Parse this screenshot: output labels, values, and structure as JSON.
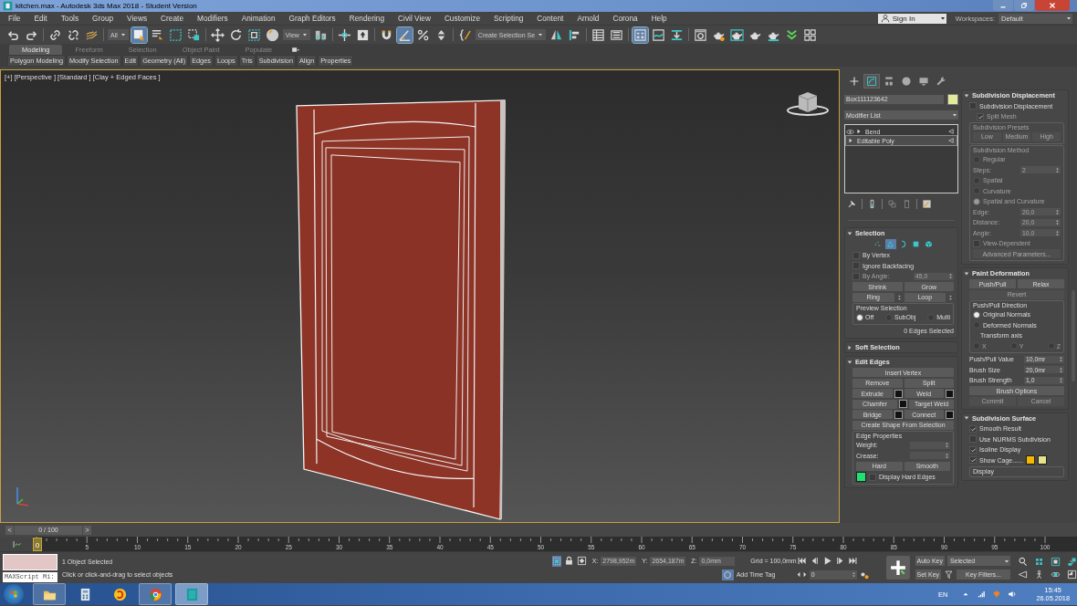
{
  "window": {
    "title": "kitchen.max - Autodesk 3ds Max 2018 - Student Version"
  },
  "menu": [
    "File",
    "Edit",
    "Tools",
    "Group",
    "Views",
    "Create",
    "Modifiers",
    "Animation",
    "Graph Editors",
    "Rendering",
    "Civil View",
    "Customize",
    "Scripting",
    "Content",
    "Arnold",
    "Corona",
    "Help"
  ],
  "account": {
    "sign_in": "Sign In",
    "workspaces_label": "Workspaces:",
    "workspace": "Default"
  },
  "toolbar": {
    "items": [
      {
        "kind": "undo",
        "selected": false
      },
      {
        "kind": "redo",
        "selected": false
      },
      {
        "kind": "sep"
      },
      {
        "kind": "link",
        "selected": false
      },
      {
        "kind": "unlink",
        "selected": false
      },
      {
        "kind": "wave",
        "selected": false
      },
      {
        "kind": "sep"
      },
      {
        "kind": "dropdown",
        "value": "All"
      },
      {
        "kind": "select",
        "selected": true
      },
      {
        "kind": "list",
        "selected": false
      },
      {
        "kind": "region",
        "selected": false
      },
      {
        "kind": "window",
        "selected": false
      },
      {
        "kind": "sep"
      },
      {
        "kind": "move",
        "selected": false
      },
      {
        "kind": "rotate",
        "selected": false
      },
      {
        "kind": "scale",
        "selected": false
      },
      {
        "kind": "sphere",
        "selected": false
      },
      {
        "kind": "dropdown",
        "value": "View"
      },
      {
        "kind": "pivot",
        "selected": false
      },
      {
        "kind": "sep"
      },
      {
        "kind": "crosshair",
        "selected": false
      },
      {
        "kind": "keyboard",
        "selected": false
      },
      {
        "kind": "sep"
      },
      {
        "kind": "snap",
        "selected": false
      },
      {
        "kind": "angle",
        "selected": true
      },
      {
        "kind": "percent",
        "selected": false
      },
      {
        "kind": "spinner",
        "selected": false
      },
      {
        "kind": "sep"
      },
      {
        "kind": "braces",
        "selected": false
      },
      {
        "kind": "dropdown",
        "value": "Create Selection Se"
      },
      {
        "kind": "mirror",
        "selected": false
      },
      {
        "kind": "align",
        "selected": false
      },
      {
        "kind": "sep"
      },
      {
        "kind": "table",
        "selected": false
      },
      {
        "kind": "layers",
        "selected": false
      },
      {
        "kind": "sep"
      },
      {
        "kind": "panels",
        "selected": true
      },
      {
        "kind": "curve",
        "selected": false
      },
      {
        "kind": "download",
        "selected": false
      },
      {
        "kind": "sep"
      },
      {
        "kind": "render",
        "selected": false
      },
      {
        "kind": "teapot-gear",
        "selected": false
      },
      {
        "kind": "teapot-frame",
        "selected": false
      },
      {
        "kind": "teapot",
        "selected": false
      },
      {
        "kind": "teapot-cloud",
        "selected": false
      },
      {
        "kind": "chevrons",
        "selected": false
      },
      {
        "kind": "grid",
        "selected": false
      }
    ]
  },
  "ribbon": {
    "tabs": [
      {
        "label": "Modeling",
        "selected": true
      },
      {
        "label": "Freeform",
        "selected": false
      },
      {
        "label": "Selection",
        "selected": false
      },
      {
        "label": "Object Paint",
        "selected": false
      },
      {
        "label": "Populate",
        "selected": false
      }
    ],
    "panels": [
      "Polygon Modeling",
      "Modify Selection",
      "Edit",
      "Geometry (All)",
      "Edges",
      "Loops",
      "Tris",
      "Subdivision",
      "Align",
      "Properties"
    ]
  },
  "viewport": {
    "labels": [
      "[+]",
      "[Perspective ]",
      "[Standard ]",
      "[Clay + Edged Faces ]"
    ]
  },
  "command_panel": {
    "tabs": [
      {
        "kind": "create",
        "selected": false
      },
      {
        "kind": "modify",
        "selected": true
      },
      {
        "kind": "hierarchy",
        "selected": false
      },
      {
        "kind": "motion",
        "selected": false
      },
      {
        "kind": "display",
        "selected": false
      },
      {
        "kind": "utilities",
        "selected": false
      }
    ],
    "object_name": "Box111123642",
    "object_swatch": {
      "color": "#e2eb9c"
    },
    "modifier_list": "Modifier List",
    "stack": [
      {
        "label": "Bend",
        "visible": true,
        "selected": false
      },
      {
        "label": "Editable Poly",
        "visible": false,
        "selected": true
      }
    ],
    "rollouts_left": [
      {
        "title": "Selection",
        "expanded": true,
        "rows": [
          {
            "kind": "levels",
            "levels": [
              {
                "selected": false
              },
              {
                "selected": true
              },
              {
                "selected": false
              },
              {
                "selected": false
              },
              {
                "selected": false
              }
            ]
          },
          {
            "kind": "check",
            "label": "By Vertex",
            "checked": false,
            "disabled": false
          },
          {
            "kind": "check",
            "label": "Ignore Backfacing",
            "checked": false,
            "disabled": false
          },
          {
            "kind": "check-spin",
            "label": "By Angle:",
            "value": "45,0",
            "checked": false,
            "disabled": true
          },
          {
            "kind": "buttons",
            "buttons": [
              {
                "label": "Shrink",
                "disabled": false
              },
              {
                "label": "Grow",
                "disabled": false
              }
            ]
          },
          {
            "kind": "buttons",
            "buttons": [
              {
                "label": "Ring",
                "disabled": false,
                "spinner": true
              },
              {
                "label": "Loop",
                "disabled": false,
                "spinner": true
              }
            ]
          },
          {
            "kind": "group",
            "title": "Preview Selection",
            "disabled": false,
            "rows": [
              {
                "kind": "radio-row",
                "options": [
                  {
                    "label": "Off",
                    "selected": true,
                    "disabled": false
                  },
                  {
                    "label": "SubObj",
                    "selected": false,
                    "disabled": false
                  },
                  {
                    "label": "Multi",
                    "selected": false,
                    "disabled": false
                  }
                ]
              }
            ]
          },
          {
            "kind": "note",
            "text": "0 Edges Selected"
          }
        ]
      },
      {
        "title": "Soft Selection",
        "expanded": false
      },
      {
        "title": "Edit Edges",
        "expanded": true,
        "rows": [
          {
            "kind": "buttons",
            "buttons": [
              {
                "label": "Insert Vertex",
                "disabled": false
              }
            ]
          },
          {
            "kind": "buttons",
            "buttons": [
              {
                "label": "Remove",
                "disabled": false
              },
              {
                "label": "Split",
                "disabled": false
              }
            ]
          },
          {
            "kind": "buttons",
            "buttons": [
              {
                "label": "Extrude",
                "disabled": false,
                "settings": true
              },
              {
                "label": "Weld",
                "disabled": false,
                "settings": true
              }
            ]
          },
          {
            "kind": "buttons",
            "buttons": [
              {
                "label": "Chamfer",
                "disabled": false,
                "settings": true
              },
              {
                "label": "Target Weld",
                "disabled": false
              }
            ]
          },
          {
            "kind": "buttons",
            "buttons": [
              {
                "label": "Bridge",
                "disabled": false,
                "settings": true
              },
              {
                "label": "Connect",
                "disabled": false,
                "settings": true
              }
            ]
          },
          {
            "kind": "buttons",
            "buttons": [
              {
                "label": "Create Shape From Selection",
                "disabled": false
              }
            ]
          },
          {
            "kind": "group",
            "title": "Edge Properties",
            "disabled": false,
            "rows": [
              {
                "kind": "spin",
                "label": "Weight:",
                "disabled": false
              },
              {
                "kind": "spin",
                "label": "Crease:",
                "disabled": false
              },
              {
                "kind": "buttons",
                "buttons": [
                  {
                    "label": "Hard",
                    "disabled": false
                  },
                  {
                    "label": "Smooth",
                    "disabled": false
                  }
                ]
              },
              {
                "kind": "check",
                "label": "Display Hard Edges",
                "checked": false,
                "disabled": false,
                "swatch": {
                  "color": "#22e070"
                }
              }
            ]
          }
        ]
      }
    ],
    "rollouts_right": [
      {
        "title": "Subdivision Displacement",
        "expanded": true,
        "rows": [
          {
            "kind": "check",
            "label": "Subdivision Displacement",
            "checked": false,
            "disabled": false
          },
          {
            "kind": "subcheck",
            "label": "Split Mesh",
            "checked": true,
            "disabled": true
          },
          {
            "kind": "group",
            "title": "Subdivision Presets",
            "disabled": true,
            "rows": [
              {
                "kind": "buttons",
                "buttons": [
                  {
                    "label": "Low",
                    "disabled": true
                  },
                  {
                    "label": "Medium",
                    "disabled": true
                  },
                  {
                    "label": "High",
                    "disabled": true
                  }
                ]
              }
            ]
          },
          {
            "kind": "group",
            "title": "Subdivision Method",
            "disabled": true,
            "rows": [
              {
                "kind": "radio",
                "label": "Regular",
                "selected": false,
                "disabled": true
              },
              {
                "kind": "spin",
                "label": "Steps:",
                "value": "2",
                "disabled": true
              },
              {
                "kind": "radio",
                "label": "Spatial",
                "selected": false,
                "disabled": true
              },
              {
                "kind": "radio",
                "label": "Curvature",
                "selected": false,
                "disabled": true
              },
              {
                "kind": "radio",
                "label": "Spatial and Curvature",
                "selected": true,
                "disabled": true
              },
              {
                "kind": "spin",
                "label": "Edge:",
                "value": "20,0",
                "disabled": true
              },
              {
                "kind": "spin",
                "label": "Distance:",
                "value": "20,0",
                "disabled": true
              },
              {
                "kind": "spin",
                "label": "Angle:",
                "value": "10,0",
                "disabled": true
              },
              {
                "kind": "check",
                "label": "View-Dependent",
                "checked": false,
                "disabled": true
              },
              {
                "kind": "buttons",
                "buttons": [
                  {
                    "label": "Advanced Parameters...",
                    "disabled": true
                  }
                ]
              }
            ]
          }
        ]
      },
      {
        "title": "Paint Deformation",
        "expanded": true,
        "rows": [
          {
            "kind": "buttons",
            "buttons": [
              {
                "label": "Push/Pull",
                "disabled": false
              },
              {
                "label": "Relax",
                "disabled": false
              }
            ]
          },
          {
            "kind": "buttons",
            "buttons": [
              {
                "label": "Revert",
                "disabled": true
              }
            ]
          },
          {
            "kind": "group",
            "title": "Push/Pull Direction",
            "disabled": false,
            "rows": [
              {
                "kind": "radio",
                "label": "Original Normals",
                "selected": true,
                "disabled": false
              },
              {
                "kind": "radio",
                "label": "Deformed Normals",
                "selected": false,
                "disabled": false
              },
              {
                "kind": "label",
                "text": "Transform axis"
              },
              {
                "kind": "radio-row",
                "options": [
                  {
                    "label": "X",
                    "selected": false,
                    "disabled": true
                  },
                  {
                    "label": "Y",
                    "selected": false,
                    "disabled": true
                  },
                  {
                    "label": "Z",
                    "selected": false,
                    "disabled": true
                  }
                ]
              }
            ]
          },
          {
            "kind": "spin",
            "label": "Push/Pull Value",
            "value": "10,0mr",
            "disabled": false
          },
          {
            "kind": "spin",
            "label": "Brush Size",
            "value": "20,0mr",
            "disabled": false
          },
          {
            "kind": "spin",
            "label": "Brush Strength",
            "value": "1,0",
            "disabled": false
          },
          {
            "kind": "buttons",
            "buttons": [
              {
                "label": "Brush Options",
                "disabled": false
              }
            ]
          },
          {
            "kind": "buttons",
            "buttons": [
              {
                "label": "Commit",
                "disabled": true
              },
              {
                "label": "Cancel",
                "disabled": true
              }
            ]
          }
        ]
      },
      {
        "title": "Subdivision Surface",
        "expanded": true,
        "rows": [
          {
            "kind": "check",
            "label": "Smooth Result",
            "checked": true,
            "disabled": false
          },
          {
            "kind": "check",
            "label": "Use NURMS Subdivision",
            "checked": false,
            "disabled": false
          },
          {
            "kind": "check",
            "label": "Isoline Display",
            "checked": true,
            "disabled": false
          },
          {
            "kind": "check",
            "label": "Show Cage......",
            "checked": true,
            "disabled": false,
            "swatches": [
              {
                "color": "#f5b800"
              },
              {
                "color": "#e6e38c"
              }
            ]
          },
          {
            "kind": "group",
            "title": "Display",
            "disabled": false
          }
        ]
      }
    ]
  },
  "timeline": {
    "prev": "<",
    "frame": "0 / 100",
    "next": ">",
    "current_frame": "0",
    "ruler": [
      "5",
      "10",
      "15",
      "20",
      "25",
      "30",
      "35",
      "40",
      "45",
      "50",
      "55",
      "60",
      "65",
      "70",
      "75",
      "80",
      "85",
      "90",
      "95",
      "100"
    ]
  },
  "status": {
    "selection": "1 Object Selected",
    "prompt": "Click or click-and-drag to select objects",
    "maxscript": "MAXScript Mi:",
    "x_label": "X:",
    "x": "2798,952m",
    "y_label": "Y:",
    "y": "2654,187m",
    "z_label": "Z:",
    "z": "0,0mm",
    "grid": "Grid = 100,0mm",
    "time_tag": "Add Time Tag",
    "frame_field": "0",
    "auto_key": "Auto Key",
    "set_key": "Set Key",
    "key_mode": "Selected",
    "key_filters": "Key Filters..."
  },
  "taskbar": {
    "apps": [
      {
        "kind": "explorer",
        "running": true,
        "selected": false
      },
      {
        "kind": "calculator",
        "running": false,
        "selected": false
      },
      {
        "kind": "onec",
        "running": false,
        "selected": false
      },
      {
        "kind": "chrome",
        "running": true,
        "selected": false
      },
      {
        "kind": "max",
        "running": true,
        "selected": true
      }
    ],
    "language": "EN",
    "time": "15:45",
    "date": "26.05.2018"
  }
}
